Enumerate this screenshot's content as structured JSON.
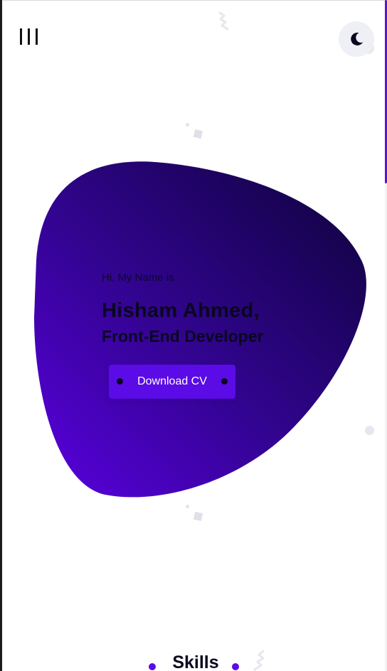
{
  "nav": {
    "menu_icon": "hamburger-vertical-bars-icon",
    "theme_icon": "moon-icon"
  },
  "hero": {
    "greeting": "Hi, My Name is",
    "name": "Hisham Ahmed,",
    "role": "Front-End Developer",
    "cta_label": "Download CV"
  },
  "sections": {
    "skills_title": "Skills"
  },
  "colors": {
    "accent": "#5b0be5",
    "blob_start": "#5a00e0",
    "blob_end": "#0d0238",
    "toggle_bg": "#eef0f6",
    "text_dark": "#0a0720"
  }
}
